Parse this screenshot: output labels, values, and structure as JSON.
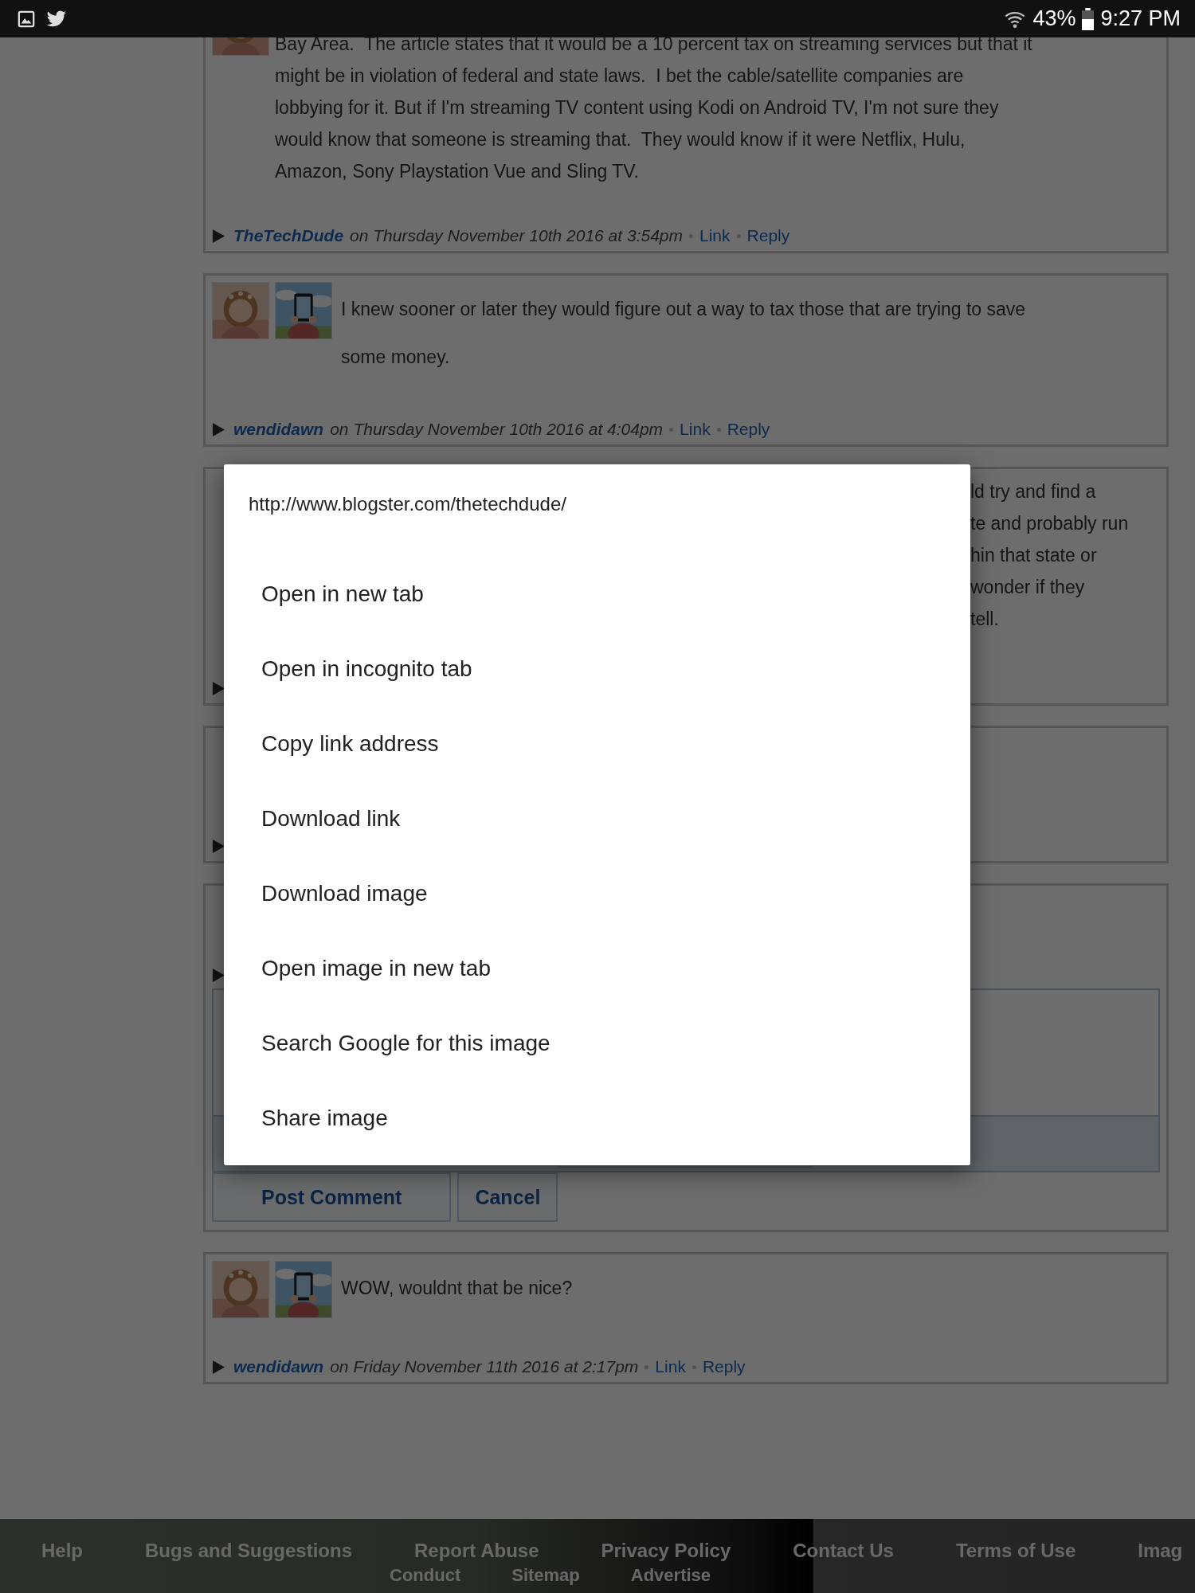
{
  "status_bar": {
    "battery": "43%",
    "time": "9:27 PM"
  },
  "comments": [
    {
      "kind": "comment",
      "avatars": [
        {
          "kind": "picture"
        }
      ],
      "lines": [
        "Bay Area.  The article states that it would be a 10 percent tax on streaming services but that it",
        "might be in violation of federal and state laws.  I bet the cable/satellite companies are",
        "lobbying for it. But if I'm streaming TV content using Kodi on Android TV, I'm not sure they",
        "would know that someone is streaming that.  They would know if it were Netflix, Hulu,",
        "Amazon, Sony Playstation Vue and Sling TV."
      ],
      "author": "TheTechDude",
      "date": "on Thursday November 10th 2016 at 3:54pm",
      "link": "Link",
      "reply": "Reply"
    },
    {
      "kind": "comment",
      "avatars": [
        {
          "kind": "picture"
        },
        {
          "kind": "picture"
        }
      ],
      "lines": [
        "I knew sooner or later they would figure out a way to tax those that are trying to save",
        "some money."
      ],
      "author": "wendidawn",
      "date": "on Thursday November 10th 2016 at 4:04pm",
      "link": "Link",
      "reply": "Reply"
    },
    {
      "kind": "partial",
      "lines": [
        "ld try and find a",
        "te and probably run",
        "hin that state or",
        "wonder if they",
        "tell."
      ]
    },
    {
      "kind": "covered"
    },
    {
      "kind": "editor",
      "post": "Post Comment",
      "cancel": "Cancel"
    },
    {
      "kind": "comment",
      "avatars": [
        {
          "kind": "picture"
        },
        {
          "kind": "picture"
        }
      ],
      "lines": [
        "WOW, wouldnt that be nice?"
      ],
      "author": "wendidawn",
      "date": "on Friday November 11th 2016 at 2:17pm",
      "link": "Link",
      "reply": "Reply"
    }
  ],
  "footer": {
    "links": [
      "Help",
      "Bugs and Suggestions",
      "Report Abuse",
      "Privacy Policy",
      "Contact Us",
      "Terms of Use",
      "Imag"
    ],
    "links_row2": [
      "Conduct",
      "Sitemap",
      "Advertise"
    ]
  },
  "context_menu": {
    "url": "http://www.blogster.com/thetechdude/",
    "items": [
      "Open in new tab",
      "Open in incognito tab",
      "Copy link address",
      "Download link",
      "Download image",
      "Open image in new tab",
      "Search Google for this image",
      "Share image"
    ]
  }
}
